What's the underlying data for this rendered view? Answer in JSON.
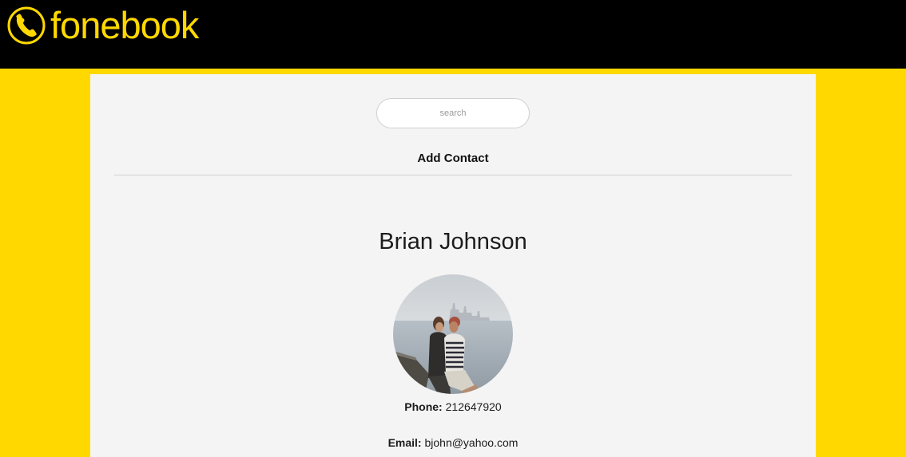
{
  "header": {
    "brand": "fonebook",
    "logo_icon": "phone-icon",
    "background_color": "#000000",
    "accent_color": "#ffd800"
  },
  "search": {
    "placeholder": "search",
    "value": ""
  },
  "actions": {
    "add_contact_label": "Add Contact"
  },
  "contact": {
    "name": "Brian Johnson",
    "avatar_icon": "contact-photo",
    "phone_label": "Phone:",
    "phone": "212647920",
    "email_label": "Email:",
    "email": "bjohn@yahoo.com"
  }
}
